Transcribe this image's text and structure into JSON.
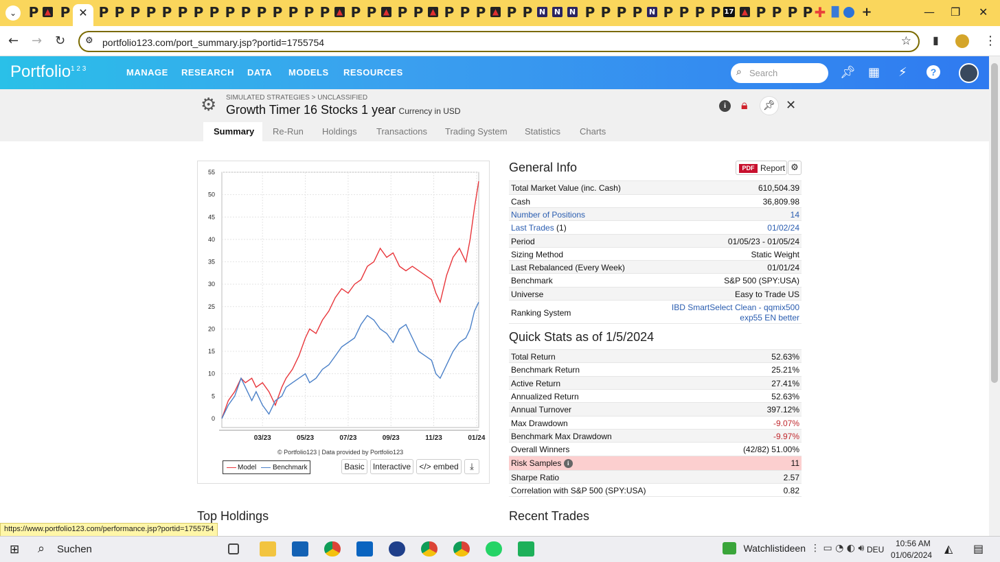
{
  "browser": {
    "url": "portfolio123.com/port_summary.jsp?portid=1755754",
    "status_url": "https://www.portfolio123.com/performance.jsp?portid=1755754"
  },
  "header": {
    "logo": "Portfolio",
    "logo_sup": "1 2 3",
    "menu": [
      "MANAGE",
      "RESEARCH",
      "DATA",
      "MODELS",
      "RESOURCES"
    ],
    "search_placeholder": "Search"
  },
  "page": {
    "breadcrumb": "SIMULATED STRATEGIES > UNCLASSIFIED",
    "title": "Growth Timer 16 Stocks 1 year",
    "currency": "Currency in USD",
    "tabs": [
      "Summary",
      "Re-Run",
      "Holdings",
      "Transactions",
      "Trading System",
      "Statistics",
      "Charts"
    ],
    "active_tab": "Summary"
  },
  "chart": {
    "credit": "© Portfolio123 | Data provided by Portfolio123",
    "legend": [
      "Model",
      "Benchmark"
    ],
    "buttons": [
      "Basic",
      "Interactive",
      "</> embed"
    ]
  },
  "chart_data": {
    "type": "line",
    "ylim": [
      -2,
      55
    ],
    "yticks": [
      0,
      5,
      10,
      15,
      20,
      25,
      30,
      35,
      40,
      45,
      50,
      55
    ],
    "xticks": [
      "03/23",
      "05/23",
      "07/23",
      "09/23",
      "11/23",
      "01/24"
    ],
    "x_range": [
      0,
      12
    ],
    "x_tick_positions": [
      1.9,
      3.9,
      5.9,
      7.9,
      9.9,
      11.9
    ],
    "series": [
      {
        "name": "Model",
        "color": "#e8353a",
        "x": [
          0,
          0.3,
          0.6,
          0.9,
          1.1,
          1.4,
          1.6,
          1.9,
          2.2,
          2.5,
          2.8,
          3.0,
          3.3,
          3.6,
          3.9,
          4.1,
          4.4,
          4.7,
          5.0,
          5.3,
          5.6,
          5.9,
          6.2,
          6.5,
          6.8,
          7.1,
          7.4,
          7.7,
          8.0,
          8.3,
          8.6,
          8.9,
          9.2,
          9.5,
          9.8,
          10.0,
          10.2,
          10.5,
          10.8,
          11.1,
          11.4,
          11.6,
          11.8,
          12.0
        ],
        "y": [
          0,
          4,
          6,
          9,
          8,
          9,
          7,
          8,
          6,
          3,
          7,
          9,
          11,
          14,
          18,
          20,
          19,
          22,
          24,
          27,
          29,
          28,
          30,
          31,
          34,
          35,
          38,
          36,
          37,
          34,
          33,
          34,
          33,
          32,
          31,
          28,
          26,
          32,
          36,
          38,
          35,
          40,
          47,
          53
        ]
      },
      {
        "name": "Benchmark",
        "color": "#4a80c8",
        "x": [
          0,
          0.3,
          0.6,
          0.9,
          1.1,
          1.4,
          1.6,
          1.9,
          2.2,
          2.5,
          2.8,
          3.0,
          3.3,
          3.6,
          3.9,
          4.1,
          4.4,
          4.7,
          5.0,
          5.3,
          5.6,
          5.9,
          6.2,
          6.5,
          6.8,
          7.1,
          7.4,
          7.7,
          8.0,
          8.3,
          8.6,
          8.9,
          9.2,
          9.5,
          9.8,
          10.0,
          10.2,
          10.5,
          10.8,
          11.1,
          11.4,
          11.6,
          11.8,
          12.0
        ],
        "y": [
          0,
          3,
          5,
          9,
          7,
          4,
          6,
          3,
          1,
          4,
          5,
          7,
          8,
          9,
          10,
          8,
          9,
          11,
          12,
          14,
          16,
          17,
          18,
          21,
          23,
          22,
          20,
          19,
          17,
          20,
          21,
          18,
          15,
          14,
          13,
          10,
          9,
          12,
          15,
          17,
          18,
          20,
          24,
          26
        ]
      }
    ]
  },
  "general_info": {
    "title": "General Info",
    "report_pdf": "PDF",
    "report_label": "Report",
    "rows": [
      {
        "k": "Total Market Value (inc. Cash)",
        "v": "610,504.39"
      },
      {
        "k": "Cash",
        "v": "36,809.98"
      },
      {
        "k": "Number of Positions",
        "v": "14"
      },
      {
        "k": "Last Trades",
        "k2": " (1)",
        "v": "01/02/24"
      },
      {
        "k": "Period",
        "v": "01/05/23 - 01/05/24"
      },
      {
        "k": "Sizing Method",
        "v": "Static Weight"
      },
      {
        "k": "Last Rebalanced (Every Week)",
        "v": "01/01/24"
      },
      {
        "k": "Benchmark",
        "v": "S&P 500 (SPY:USA)"
      },
      {
        "k": "Universe",
        "v": "Easy to Trade US"
      },
      {
        "k": "Ranking System",
        "v": "IBD SmartSelect Clean - qqmix500",
        "v2": "exp55 EN better"
      }
    ]
  },
  "quick_stats": {
    "title": "Quick Stats as of 1/5/2024",
    "rows": [
      {
        "k": "Total Return",
        "v": "52.63%"
      },
      {
        "k": "Benchmark Return",
        "v": "25.21%"
      },
      {
        "k": "Active Return",
        "v": "27.41%"
      },
      {
        "k": "Annualized Return",
        "v": "52.63%"
      },
      {
        "k": "Annual Turnover",
        "v": "397.12%"
      },
      {
        "k": "Max Drawdown",
        "v": "-9.07%"
      },
      {
        "k": "Benchmark Max Drawdown",
        "v": "-9.97%"
      },
      {
        "k": "Overall Winners",
        "v": "(42/82) 51.00%"
      },
      {
        "k": "Risk Samples",
        "v": "11"
      },
      {
        "k": "Sharpe Ratio",
        "v": "2.57"
      },
      {
        "k": "Correlation with S&P 500 (SPY:USA)",
        "v": "0.82"
      }
    ]
  },
  "bottom": {
    "top_holdings": "Top Holdings",
    "recent_trades": "Recent Trades"
  },
  "taskbar": {
    "search": "Suchen",
    "widget": "Watchlistideen",
    "lang": "DEU",
    "time": "10:56 AM",
    "date": "01/06/2024"
  }
}
